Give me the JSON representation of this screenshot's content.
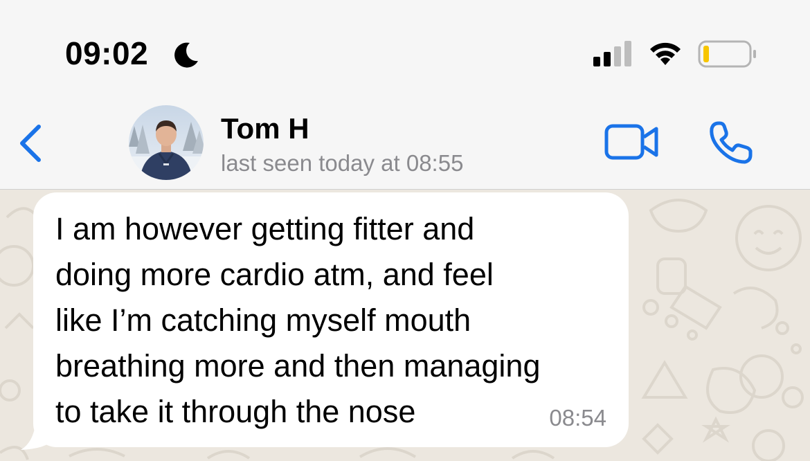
{
  "status_bar": {
    "time": "09:02",
    "focus_icon": "moon-icon",
    "signal_icon": "cellular-signal-icon",
    "wifi_icon": "wifi-icon",
    "battery_icon": "battery-low-icon",
    "battery_level": 0.1
  },
  "header": {
    "back_icon": "chevron-left-icon",
    "contact_name": "Tom H",
    "last_seen": "last seen today at 08:55",
    "video_icon": "video-camera-icon",
    "call_icon": "phone-icon",
    "accent_color": "#1a73e8"
  },
  "message": {
    "lines": [
      "I am however getting fitter and",
      "doing more cardio atm, and feel",
      "like I’m catching myself mouth",
      "breathing more and then managing",
      "to take it through the nose"
    ],
    "time": "08:54"
  },
  "colors": {
    "chat_background": "#ece7df",
    "bubble_incoming": "#ffffff",
    "battery_fill": "#f7c500"
  }
}
